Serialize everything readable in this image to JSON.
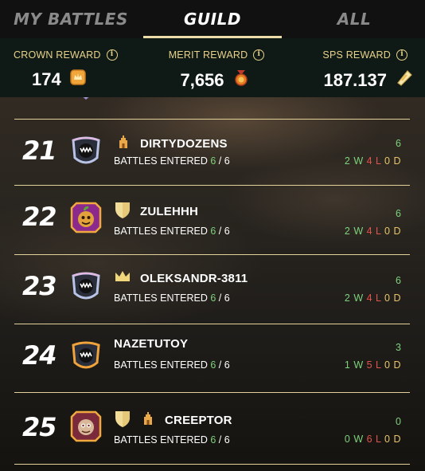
{
  "tabs": [
    {
      "label": "MY BATTLES",
      "active": false
    },
    {
      "label": "GUILD",
      "active": true
    },
    {
      "label": "ALL",
      "active": false
    }
  ],
  "rewards": [
    {
      "title": "CROWN REWARD",
      "value": "174",
      "icon": "crown-token-icon"
    },
    {
      "title": "MERIT REWARD",
      "value": "7,656",
      "icon": "merit-medal-icon"
    },
    {
      "title": "SPS REWARD",
      "value": "187.137",
      "icon": "sps-token-icon"
    }
  ],
  "info_glyph": "i",
  "battles_label": "BATTLES ENTERED",
  "w_suffix": "W",
  "l_suffix": "L",
  "d_suffix": "D",
  "slash": "/",
  "rows": [
    {
      "rank": "21",
      "avatar": "guild-emblem-monster-icon",
      "badges": [
        "tower-icon"
      ],
      "name": "DIRTYDOZENS",
      "battles_entered": "6",
      "battles_total": "6",
      "score": "6",
      "wins": "2",
      "losses": "4",
      "draws": "0"
    },
    {
      "rank": "22",
      "avatar": "pumpkin-avatar-icon",
      "badges": [
        "shield-icon"
      ],
      "name": "ZULEHHH",
      "battles_entered": "6",
      "battles_total": "6",
      "score": "6",
      "wins": "2",
      "losses": "4",
      "draws": "0"
    },
    {
      "rank": "23",
      "avatar": "guild-emblem-monster-icon",
      "badges": [
        "crown-icon"
      ],
      "name": "OLEKSANDR-3811",
      "battles_entered": "6",
      "battles_total": "6",
      "score": "6",
      "wins": "2",
      "losses": "4",
      "draws": "0"
    },
    {
      "rank": "24",
      "avatar": "guild-emblem-monster-orange-icon",
      "badges": [],
      "name": "NAZETUTOY",
      "battles_entered": "6",
      "battles_total": "6",
      "score": "3",
      "wins": "1",
      "losses": "5",
      "draws": "0"
    },
    {
      "rank": "25",
      "avatar": "creature-avatar-icon",
      "badges": [
        "shield-icon",
        "tower-icon"
      ],
      "name": "CREEPTOR",
      "battles_entered": "6",
      "battles_total": "6",
      "score": "0",
      "wins": "0",
      "losses": "6",
      "draws": "0"
    }
  ],
  "colors": {
    "accent": "#ecdca8",
    "gold": "#e8d28a",
    "win": "#7fd27c",
    "loss": "#e2534a",
    "draw": "#e8c46a"
  }
}
